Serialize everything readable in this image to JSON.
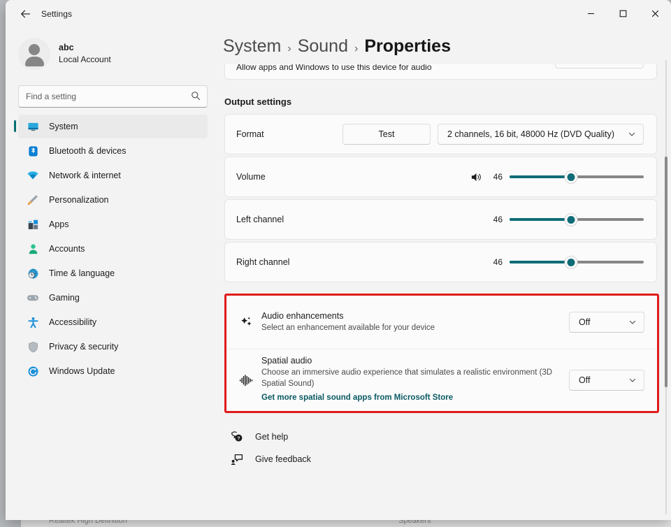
{
  "window": {
    "title": "Settings",
    "back_icon": "arrow-left-icon",
    "controls": {
      "minimize": "minimize-icon",
      "maximize": "maximize-icon",
      "close": "close-icon"
    }
  },
  "background_window": {
    "ghost_text_left": "Realtek High Definition",
    "ghost_text_right": "Speakers"
  },
  "sidebar": {
    "account": {
      "name": "abc",
      "subtitle": "Local Account",
      "avatar_icon": "person-avatar-icon"
    },
    "search": {
      "placeholder": "Find a setting",
      "icon": "search-icon",
      "value": ""
    },
    "items": [
      {
        "label": "System",
        "icon": "monitor-icon",
        "selected": true
      },
      {
        "label": "Bluetooth & devices",
        "icon": "bluetooth-icon",
        "selected": false
      },
      {
        "label": "Network & internet",
        "icon": "wifi-icon",
        "selected": false
      },
      {
        "label": "Personalization",
        "icon": "paintbrush-icon",
        "selected": false
      },
      {
        "label": "Apps",
        "icon": "apps-icon",
        "selected": false
      },
      {
        "label": "Accounts",
        "icon": "person-icon",
        "selected": false
      },
      {
        "label": "Time & language",
        "icon": "clock-globe-icon",
        "selected": false
      },
      {
        "label": "Gaming",
        "icon": "gamepad-icon",
        "selected": false
      },
      {
        "label": "Accessibility",
        "icon": "accessibility-icon",
        "selected": false
      },
      {
        "label": "Privacy & security",
        "icon": "shield-icon",
        "selected": false
      },
      {
        "label": "Windows Update",
        "icon": "update-icon",
        "selected": false
      }
    ]
  },
  "breadcrumb": {
    "segments": [
      "System",
      "Sound",
      "Properties"
    ],
    "separator": "›"
  },
  "content": {
    "clipped_card": {
      "label": "Allow apps and Windows to use this device for audio"
    },
    "section_title": "Output settings",
    "format_row": {
      "label": "Format",
      "test_button": "Test",
      "value": "2 channels, 16 bit, 48000 Hz (DVD Quality)",
      "chevron_icon": "chevron-down-icon"
    },
    "volume_row": {
      "label": "Volume",
      "icon": "speaker-icon",
      "value": "46",
      "percent": 46
    },
    "left_channel_row": {
      "label": "Left channel",
      "value": "46",
      "percent": 46
    },
    "right_channel_row": {
      "label": "Right channel",
      "value": "46",
      "percent": 46
    },
    "audio_enhancements": {
      "icon": "sparkle-icon",
      "title": "Audio enhancements",
      "description": "Select an enhancement available for your device",
      "value": "Off",
      "chevron_icon": "chevron-down-icon"
    },
    "spatial_audio": {
      "icon": "waveform-icon",
      "title": "Spatial audio",
      "description": "Choose an immersive audio experience that simulates a realistic environment (3D Spatial Sound)",
      "link": "Get more spatial sound apps from Microsoft Store",
      "value": "Off",
      "chevron_icon": "chevron-down-icon"
    },
    "footer": {
      "get_help": {
        "label": "Get help",
        "icon": "help-icon"
      },
      "give_feedback": {
        "label": "Give feedback",
        "icon": "feedback-icon"
      }
    }
  },
  "colors": {
    "accent_teal": "#0f6c77",
    "highlight_red": "#e01b1b",
    "link_teal": "#0a5a63",
    "window_bg": "#f3f3f3",
    "card_bg": "#fbfbfb"
  }
}
